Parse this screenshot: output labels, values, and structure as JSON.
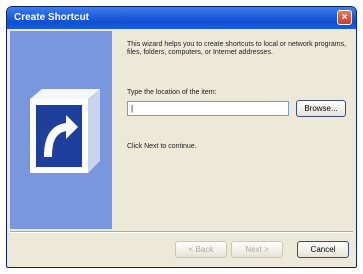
{
  "window": {
    "title": "Create Shortcut",
    "close_glyph": "×"
  },
  "content": {
    "intro": "This wizard helps you to create shortcuts to local or network programs, files, folders, computers, or Internet addresses.",
    "prompt": "Type the location of the item:",
    "location_value": "|",
    "browse_label": "Browse...",
    "hint": "Click Next to continue."
  },
  "buttons": {
    "back": "< Back",
    "next": "Next >",
    "cancel": "Cancel"
  },
  "colors": {
    "titlebar": "#2260dc",
    "side_panel": "#7a96df",
    "dialog_bg": "#ece9d8"
  },
  "icons": {
    "side_art": "shortcut-arrow-icon"
  }
}
